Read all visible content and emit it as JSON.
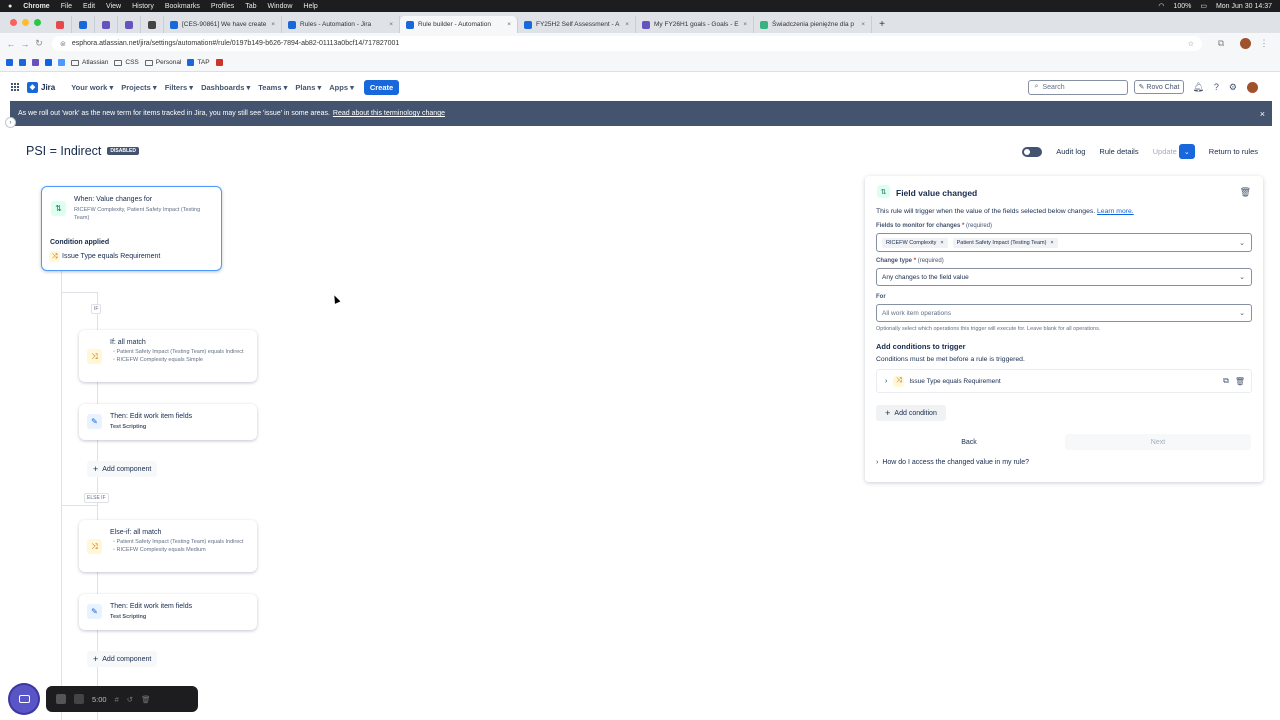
{
  "mac_menu": {
    "app": "Chrome",
    "items": [
      "File",
      "Edit",
      "View",
      "History",
      "Bookmarks",
      "Profiles",
      "Tab",
      "Window",
      "Help"
    ],
    "battery": "100%",
    "clock": "Mon Jun 30  14:37"
  },
  "tabs": [
    {
      "title": "[CES-90861] We have create",
      "color": "#1868db"
    },
    {
      "title": "Rules - Automation - Jira",
      "color": "#1868db"
    },
    {
      "title": "Rule builder - Automation",
      "color": "#1868db",
      "active": true
    },
    {
      "title": "FY25H2 Self Assessment - A",
      "color": "#1868db"
    },
    {
      "title": "My FY26H1 goals - Goals - E",
      "color": "#6554c0"
    },
    {
      "title": "Świadczenia pieniężne dla p",
      "color": "#36b37e"
    }
  ],
  "address": {
    "url": "esphora.atlassian.net/jira/settings/automation#/rule/0197b149-b626-7894-ab82-01113a0bcf14/717827001"
  },
  "bookmarks": [
    "Atlassian",
    "CSS",
    "Personal",
    "TAP"
  ],
  "jira_nav": {
    "product": "Jira",
    "menu": [
      "Your work",
      "Projects",
      "Filters",
      "Dashboards",
      "Teams",
      "Plans",
      "Apps"
    ],
    "create_label": "Create",
    "search_placeholder": "Search",
    "rovo_label": "Rovo Chat"
  },
  "banner": {
    "text": "As we roll out 'work' as the new term for items tracked in Jira, you may still see 'issue' in some areas.",
    "link": "Read about this terminology change"
  },
  "rule": {
    "name": "PSI = Indirect",
    "status": "DISABLED",
    "actions": {
      "audit_log": "Audit log",
      "rule_details": "Rule details",
      "update": "Update",
      "return": "Return to rules"
    }
  },
  "canvas": {
    "trigger": {
      "title": "When: Value changes for",
      "fields": "RICEFW Complexity, Patient Safety Impact (Testing Team)",
      "condition_label": "Condition applied",
      "condition": "Issue Type equals Requirement"
    },
    "if_tag": "IF",
    "if_block": {
      "title": "If: all match",
      "line1": "Patient Safety Impact (Testing Team) equals Indirect",
      "line2": "RICEFW Complexity equals Simple"
    },
    "then1": {
      "title": "Then: Edit work item fields",
      "sub": "Test Scripting"
    },
    "add_component": "Add component",
    "elseif_tag": "ELSE IF",
    "elseif_block": {
      "title": "Else-if: all match",
      "line1": "Patient Safety Impact (Testing Team) equals Indirect",
      "line2": "RICEFW Complexity equals Medium"
    },
    "then2": {
      "title": "Then: Edit work item fields",
      "sub": "Test Scripting"
    }
  },
  "panel": {
    "title": "Field value changed",
    "desc": "This rule will trigger when the value of the fields selected below changes.",
    "learn_more": "Learn more.",
    "fields_label": "Fields to monitor for changes",
    "required": "(required)",
    "chips": [
      "RICEFW Complexity",
      "Patient Safety Impact (Testing Team)"
    ],
    "change_type_label": "Change type",
    "change_type_value": "Any changes to the field value",
    "for_label": "For",
    "for_placeholder": "All work item operations",
    "for_help": "Optionally select which operations this trigger will execute for. Leave blank for all operations.",
    "conditions_title": "Add conditions to trigger",
    "conditions_desc": "Conditions must be met before a rule is triggered.",
    "condition_item": "Issue Type equals Requirement",
    "add_condition": "Add condition",
    "back": "Back",
    "next": "Next",
    "faq": "How do I access the changed value in my rule?"
  },
  "recorder": {
    "time": "5:00"
  },
  "colors": {
    "brand": "#1868db",
    "banner": "#44546f"
  }
}
